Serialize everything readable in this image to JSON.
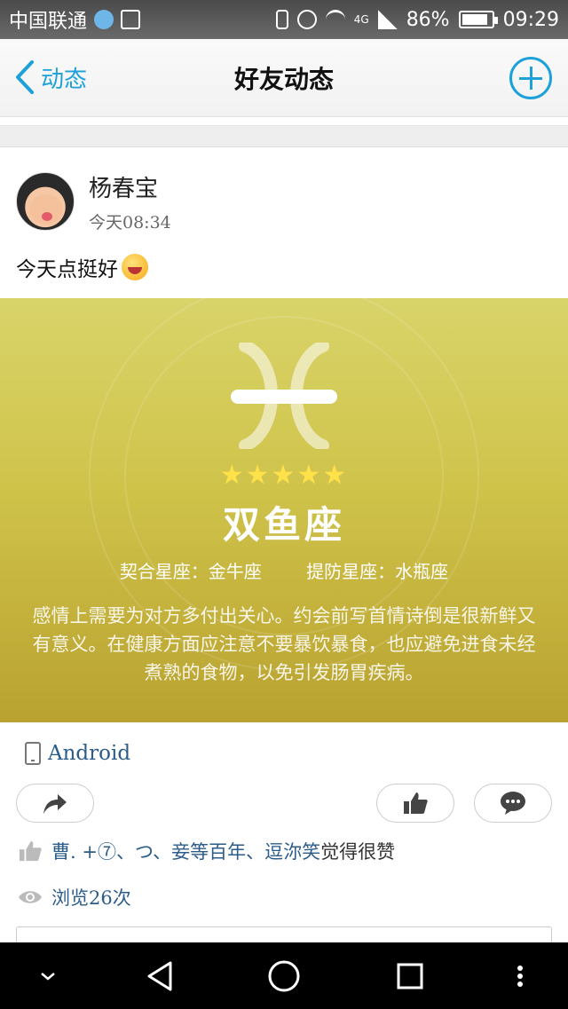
{
  "status_bar": {
    "carrier": "中国联通",
    "network": "4G",
    "battery_text": "86%",
    "battery_level": 0.86,
    "time": "09:29"
  },
  "nav": {
    "back_label": "动态",
    "title": "好友动态",
    "add_icon": "plus-circle-icon"
  },
  "post": {
    "username": "杨春宝",
    "time": "今天08:34",
    "text": "今天点挺好",
    "emoji": "grinning-face-icon",
    "horoscope": {
      "rating_stars": 5,
      "stars_text": "★★★★★",
      "sign_name": "双鱼座",
      "match_label": "契合星座：金牛座",
      "avoid_label": "提防星座：水瓶座",
      "description": "感情上需要为对方多付出关心。约会前写首情诗倒是很新鲜又有意义。在健康方面应注意不要暴饮暴食，也应避免进食未经煮熟的食物，以免引发肠胃疾病。"
    },
    "device": "Android",
    "likes_names": "曹. +⑦、つ、妾等百年、逗沵笑",
    "likes_suffix": "觉得很赞",
    "views": "浏览26次"
  },
  "colors": {
    "accent": "#1da1d8",
    "link": "#2b5c8a",
    "horoscope_bg": "#cfc34a"
  }
}
